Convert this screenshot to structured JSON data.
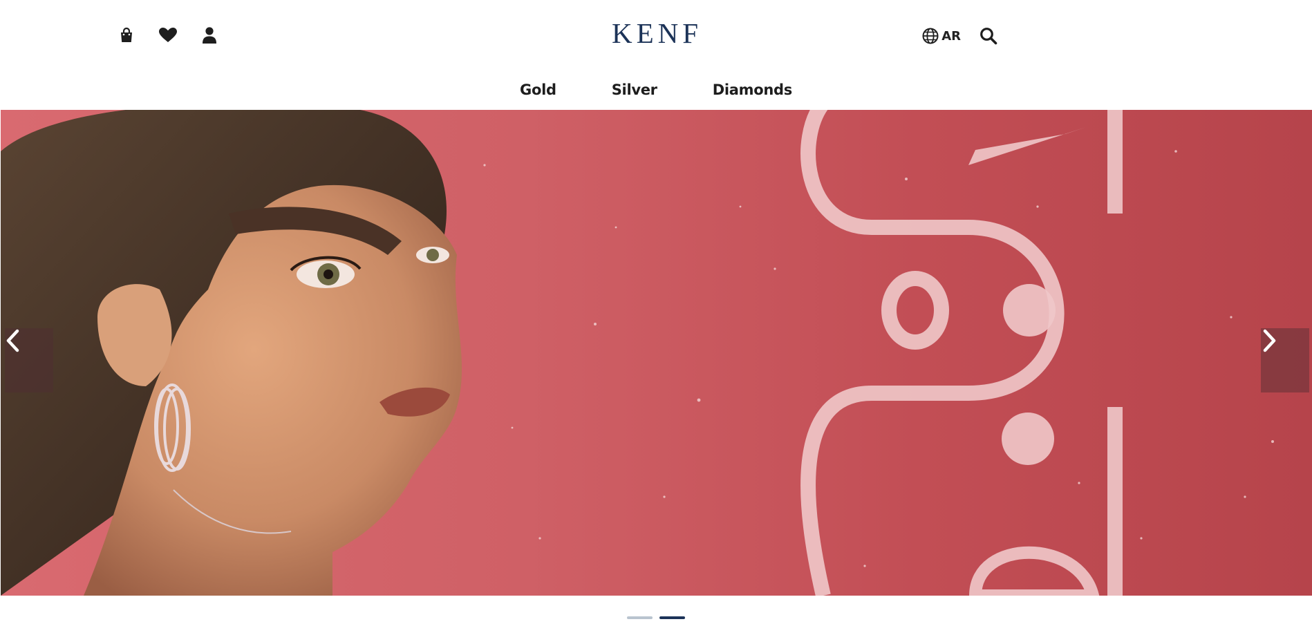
{
  "header": {
    "logo_text": "KENF",
    "icons_left": [
      "shopping-bag-icon",
      "heart-icon",
      "user-icon"
    ],
    "language_label": "AR",
    "icons_right": [
      "globe-icon",
      "search-icon"
    ]
  },
  "nav": {
    "items": [
      {
        "label": "Gold"
      },
      {
        "label": "Silver"
      },
      {
        "label": "Diamonds"
      }
    ]
  },
  "hero": {
    "slide_description_icons": [
      "chevron-left-icon",
      "chevron-right-icon"
    ],
    "background_color": "#cf6066",
    "slide_count": 2,
    "active_slide_index": 1
  },
  "colors": {
    "brand_navy": "#1c3358",
    "inactive_dot": "#b9c4cf"
  }
}
